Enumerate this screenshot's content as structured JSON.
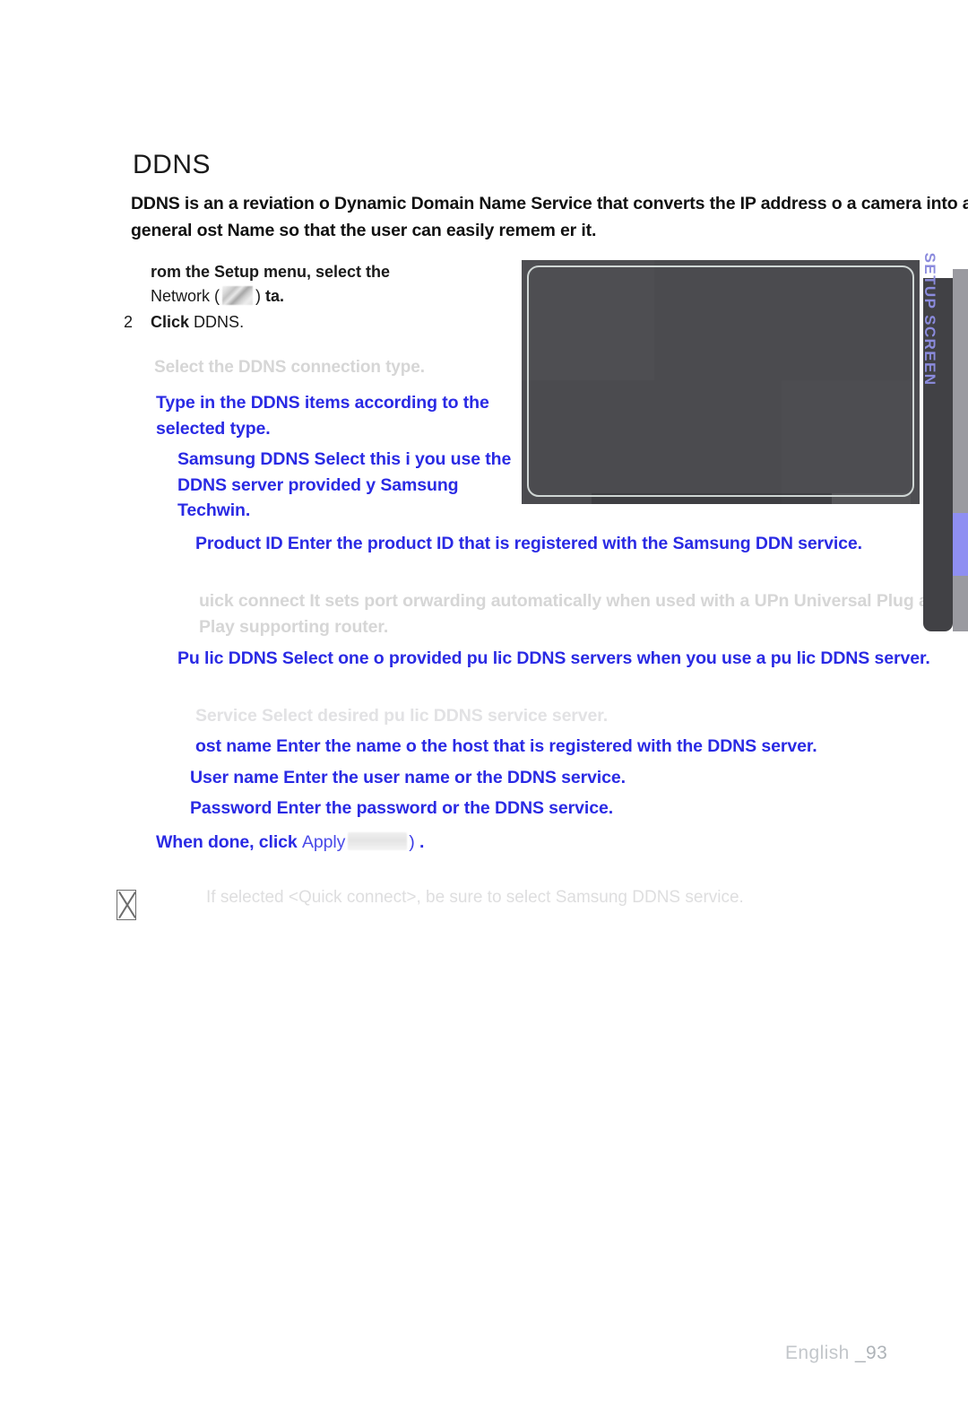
{
  "page": {
    "section_title": "DDNS",
    "intro": "DDNS is an a reviation o  Dynamic Domain Name Service that converts the IP address o  a camera into a general  ost Name so that the user can easily remem er it.",
    "footer_language": "English",
    "footer_page": "_93"
  },
  "steps": [
    {
      "number": "",
      "bold_text": "rom the Setup menu, select the",
      "rest_before_icon": "Network (",
      "icon": "network-tab-icon",
      "rest_after_icon": ")",
      "trailing_bold": "ta",
      "trailing_period": "."
    },
    {
      "number": "2",
      "bold_text": "Click",
      "normal_text": "DDNS",
      "trailing_period": "."
    }
  ],
  "body": {
    "select_type": "Select the  DDNS  connection type.",
    "type_in": "Type in the DDNS items according to the selected type.",
    "samsung_ddns": "Samsung DDNS  Select this i  you use the DDNS server provided  y Samsung Techwin.",
    "product_id": "Product ID  Enter the product ID that is registered with the Samsung DDN service.",
    "quick_connect": "uick connect  It sets port  orwarding automatically when used with a UPn Universal Plug and Play  supporting router.",
    "public_ddns": "Pu lic DDNS  Select one o  provided pu lic DDNS servers when you use a pu lic DDNS server.",
    "service": "Service  Select desired pu lic DDNS service server.",
    "host_name": "ost name  Enter the name o  the host that is registered with the DDNS server.",
    "user_name": "User name  Enter the user name  or the DDNS service.",
    "password": "Password  Enter the password  or the DDNS service.",
    "when_done_prefix": "When done, click",
    "apply_label": "Apply",
    "apply_button_icon": "apply-button-image",
    "when_done_suffix": ")",
    "when_done_period": "."
  },
  "note": {
    "glyph": "missing-glyph-box-icon",
    "text": "If selected <Quick connect>, be sure to select Samsung DDNS service."
  },
  "screenshot": {
    "alt": "setup-screen-capture"
  },
  "side_tab": {
    "label": "SETUP SCREEN"
  },
  "colors": {
    "blue": "#2a2ae4",
    "faded_gray": "#d6d6d6",
    "tab_label": "#8b8bdd",
    "rail_active": "#8f8ff2"
  }
}
